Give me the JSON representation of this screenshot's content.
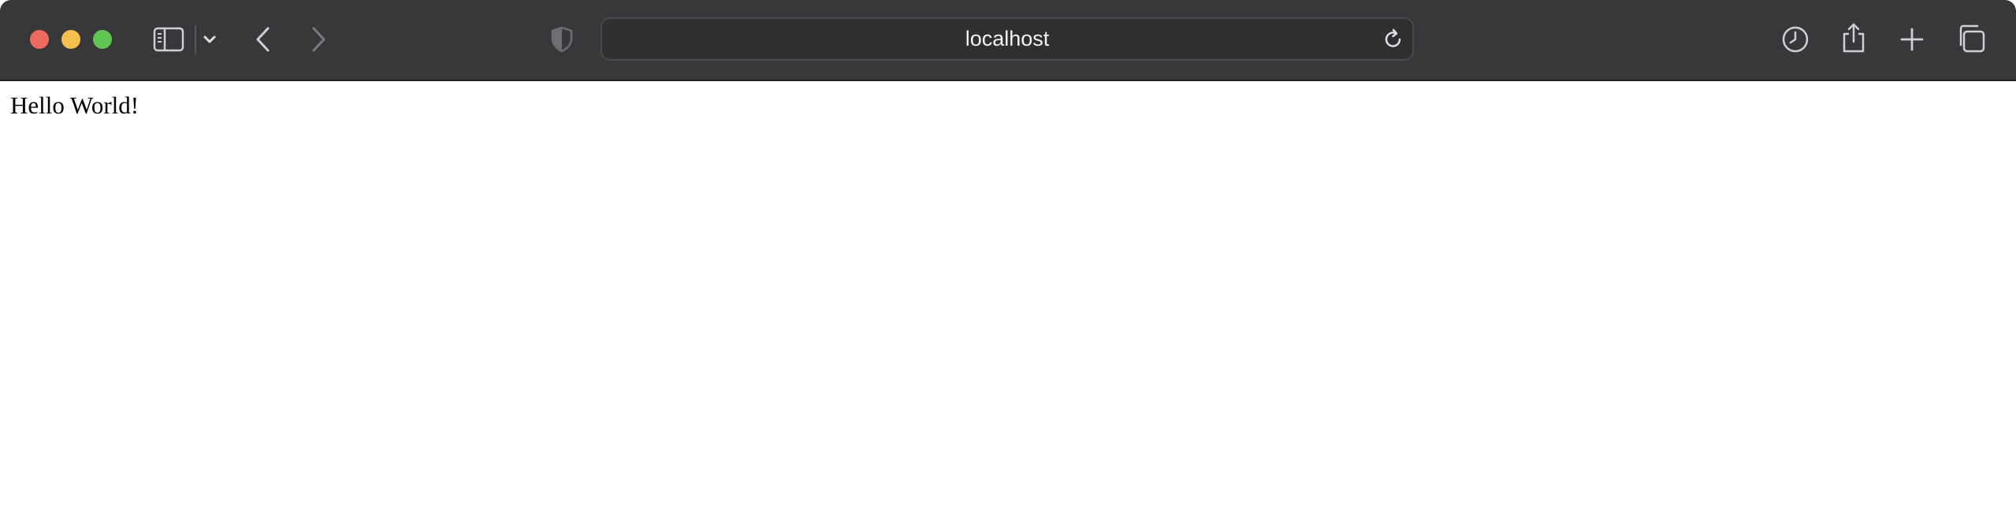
{
  "browser": {
    "address_bar": {
      "url": "localhost"
    },
    "toolbar_icons": [
      "sidebar-icon",
      "chevron-down-icon",
      "back-arrow-icon",
      "forward-arrow-icon",
      "shield-icon",
      "reload-icon",
      "history-clock-icon",
      "share-icon",
      "plus-icon",
      "tab-overview-icon"
    ],
    "colors": {
      "toolbar": "#38383b",
      "close": "#ed6a5e",
      "minimize": "#f5bf4f",
      "zoom": "#61c554"
    }
  },
  "page": {
    "body_text": "Hello World!"
  }
}
